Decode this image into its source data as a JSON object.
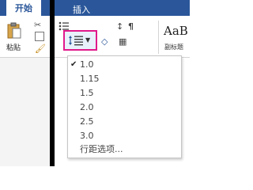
{
  "ribbon": {
    "tabs": [
      "开始",
      "插入"
    ],
    "clipboard": {
      "paste_label": "粘贴"
    },
    "styles": {
      "sample": "AaB",
      "name": "副标题"
    }
  },
  "line_spacing_menu": {
    "items": [
      "1.0",
      "1.15",
      "1.5",
      "2.0",
      "2.5",
      "3.0",
      "行距选项..."
    ],
    "selected": "1.0"
  }
}
